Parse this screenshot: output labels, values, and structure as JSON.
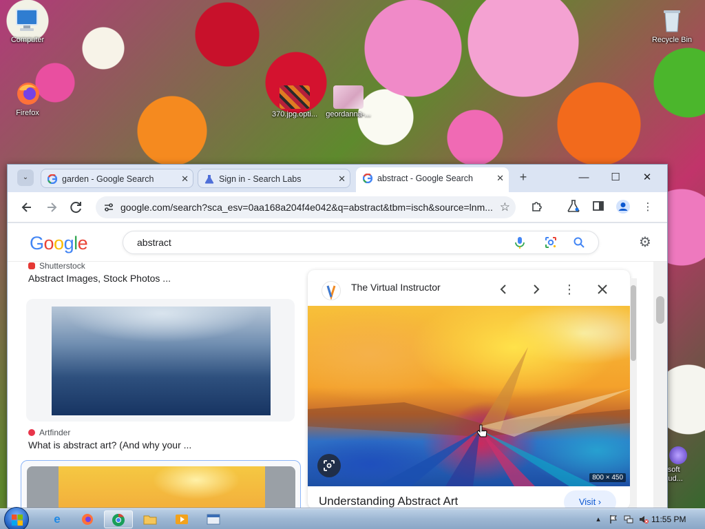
{
  "desktop": {
    "icons": [
      {
        "label": "Computer"
      },
      {
        "label": "Firefox"
      },
      {
        "label": "370.jpg.opti..."
      },
      {
        "label": "geordanna-..."
      },
      {
        "label": "Recycle Bin"
      },
      {
        "label": "rosoft Stud..."
      }
    ]
  },
  "browser": {
    "tabs": [
      {
        "label": "garden - Google Search",
        "active": false
      },
      {
        "label": "Sign in - Search Labs",
        "active": false
      },
      {
        "label": "abstract - Google Search",
        "active": true
      }
    ],
    "url": "google.com/search?sca_esv=0aa168a204f4e042&q=abstract&tbm=isch&source=lnm...",
    "icons": {
      "back": "back-arrow-icon",
      "forward": "forward-arrow-icon",
      "reload": "reload-icon",
      "site_info": "tune-icon",
      "bookmark": "star-icon",
      "extensions": "puzzle-icon",
      "labs": "flask-icon",
      "side_panel": "side-panel-icon",
      "profile": "profile-icon",
      "menu": "kebab-menu-icon"
    }
  },
  "google": {
    "logo_letters": [
      "G",
      "o",
      "o",
      "g",
      "l",
      "e"
    ],
    "query": "abstract"
  },
  "results": [
    {
      "source": "Shutterstock",
      "title": "Abstract Images, Stock Photos ...",
      "source_color": "#e53935"
    },
    {
      "source": "Artfinder",
      "title": "What is abstract art? (And why your ...",
      "source_color": "#e8354a"
    }
  ],
  "panel": {
    "source": "The Virtual Instructor",
    "dimensions": "800 × 450",
    "title": "Understanding Abstract Art",
    "visit_label": "Visit"
  },
  "taskbar": {
    "clock": "11:55 PM"
  },
  "colors": {
    "google_blue": "#4285f4",
    "accent_blue": "#0b57d0",
    "tab_strip": "#dbe4f3"
  }
}
